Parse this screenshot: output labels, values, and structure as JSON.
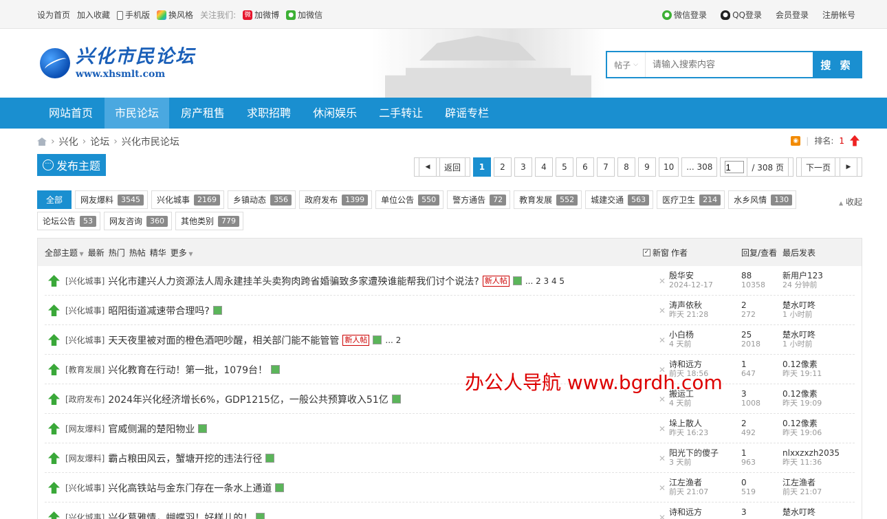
{
  "topbar": {
    "set_home": "设为首页",
    "add_fav": "加入收藏",
    "mobile": "手机版",
    "skin": "换风格",
    "follow": "关注我们:",
    "weibo": "加微博",
    "wechat": "加微信",
    "wechat_login": "微信登录",
    "qq_login": "QQ登录",
    "member_login": "会员登录",
    "register": "注册帐号"
  },
  "header": {
    "logo_cn": "兴化市民论坛",
    "logo_url": "www.xhsmlt.com",
    "search_type": "帖子",
    "search_placeholder": "请输入搜索内容",
    "search_button": "搜 索"
  },
  "nav": [
    "网站首页",
    "市民论坛",
    "房产租售",
    "求职招聘",
    "休闲娱乐",
    "二手转让",
    "辟谣专栏"
  ],
  "breadcrumb": [
    "兴化",
    "论坛",
    "兴化市民论坛"
  ],
  "rank": {
    "label": "排名:",
    "value": "1"
  },
  "post_button": "发布主题",
  "pager": {
    "back": "返回",
    "pages": [
      "1",
      "2",
      "3",
      "4",
      "5",
      "6",
      "7",
      "8",
      "9",
      "10",
      "... 308"
    ],
    "current": "1",
    "input_value": "1",
    "total": "/ 308 页",
    "next": "下一页"
  },
  "categories": {
    "all": "全部",
    "items": [
      {
        "name": "网友爆料",
        "count": "3545"
      },
      {
        "name": "兴化城事",
        "count": "2169"
      },
      {
        "name": "乡镇动态",
        "count": "356"
      },
      {
        "name": "政府发布",
        "count": "1399"
      },
      {
        "name": "单位公告",
        "count": "550"
      },
      {
        "name": "警方通告",
        "count": "72"
      },
      {
        "name": "教育发展",
        "count": "552"
      },
      {
        "name": "城建交通",
        "count": "563"
      },
      {
        "name": "医疗卫生",
        "count": "214"
      },
      {
        "name": "水乡风情",
        "count": "130"
      },
      {
        "name": "论坛公告",
        "count": "53"
      },
      {
        "name": "网友咨询",
        "count": "360"
      },
      {
        "name": "其他类别",
        "count": "779"
      }
    ],
    "collapse": "收起"
  },
  "table_head": {
    "all_topics": "全部主题",
    "filters": [
      "最新",
      "热门",
      "热帖",
      "精华",
      "更多"
    ],
    "new_window": "新窗",
    "author": "作者",
    "reply_view": "回复/查看",
    "last_post": "最后发表"
  },
  "threads": [
    {
      "type": "[兴化城事]",
      "title": "兴化市建兴人力资源法人周永建挂羊头卖狗肉跨省婚骗致多家遭殃谁能帮我们讨个说法?",
      "new": "新人帖",
      "pages": "... 2  3  4  5",
      "author": "殷华安",
      "date": "2024-12-17",
      "replies": "88",
      "views": "10358",
      "last_user": "新用户123",
      "last_time": "24 分钟前"
    },
    {
      "type": "[兴化城事]",
      "title": "昭阳街道减速带合理吗?",
      "new": "",
      "pages": "",
      "author": "涛声依秋",
      "date": "昨天 21:28",
      "replies": "2",
      "views": "272",
      "last_user": "楚水叮咚",
      "last_time": "1 小时前"
    },
    {
      "type": "[兴化城事]",
      "title": "天天夜里被对面的橙色酒吧吵醒，相关部门能不能管管",
      "new": "新人帖",
      "pages": "... 2",
      "author": "小白杨",
      "date": "4 天前",
      "replies": "25",
      "views": "2018",
      "last_user": "楚水叮咚",
      "last_time": "1 小时前"
    },
    {
      "type": "[教育发展]",
      "title": "兴化教育在行动！第一批，1079台！",
      "new": "",
      "pages": "",
      "author": "诗和远方",
      "date": "前天 18:56",
      "replies": "1",
      "views": "647",
      "last_user": "0.12像素",
      "last_time": "昨天 19:11"
    },
    {
      "type": "[政府发布]",
      "title": "2024年兴化经济增长6%，GDP1215亿，一般公共预算收入51亿",
      "new": "",
      "pages": "",
      "author": "搬运工",
      "date": "4 天前",
      "replies": "3",
      "views": "1008",
      "last_user": "0.12像素",
      "last_time": "昨天 19:09"
    },
    {
      "type": "[网友爆料]",
      "title": "官威侧漏的楚阳物业",
      "new": "",
      "pages": "",
      "author": "垛上散人",
      "date": "昨天 16:23",
      "replies": "2",
      "views": "492",
      "last_user": "0.12像素",
      "last_time": "昨天 19:06"
    },
    {
      "type": "[网友爆料]",
      "title": "霸占粮田风云，蟹塘开挖的违法行径",
      "new": "",
      "pages": "",
      "author": "阳光下的傻子",
      "date": "3 天前",
      "replies": "1",
      "views": "963",
      "last_user": "nlxxzxzh2035",
      "last_time": "昨天 11:36"
    },
    {
      "type": "[兴化城事]",
      "title": "兴化高铁站与金东门存在一条水上通道",
      "new": "",
      "pages": "",
      "author": "江左渔者",
      "date": "前天 21:07",
      "replies": "0",
      "views": "519",
      "last_user": "江左渔者",
      "last_time": "前天 21:07"
    },
    {
      "type": "[兴化城事]",
      "title": "兴化葛雅情，蝴蝶羽！好样儿的！",
      "new": "",
      "pages": "",
      "author": "诗和远方",
      "date": "",
      "replies": "3",
      "views": "",
      "last_user": "楚水叮咚",
      "last_time": ""
    }
  ],
  "watermark": "办公人导航 www.bgrdh.com"
}
